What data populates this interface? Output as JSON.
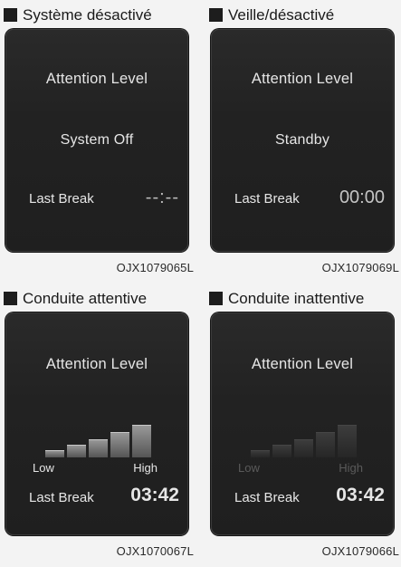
{
  "panels": [
    {
      "header": "Système désactivé",
      "title": "Attention Level",
      "status": "System Off",
      "last_break_label": "Last Break",
      "last_break_value": "--:--",
      "code": "OJX1079065L"
    },
    {
      "header": "Veille/désactivé",
      "title": "Attention Level",
      "status": "Standby",
      "last_break_label": "Last Break",
      "last_break_value": "00:00",
      "code": "OJX1079069L"
    },
    {
      "header": "Conduite attentive",
      "title": "Attention Level",
      "low_label": "Low",
      "high_label": "High",
      "attention_level_bars_lit": 5,
      "last_break_label": "Last Break",
      "last_break_value": "03:42",
      "code": "OJX1070067L"
    },
    {
      "header": "Conduite inattentive",
      "title": "Attention Level",
      "low_label": "Low",
      "high_label": "High",
      "attention_level_bars_lit": 0,
      "last_break_label": "Last Break",
      "last_break_value": "03:42",
      "code": "OJX1079066L"
    }
  ]
}
